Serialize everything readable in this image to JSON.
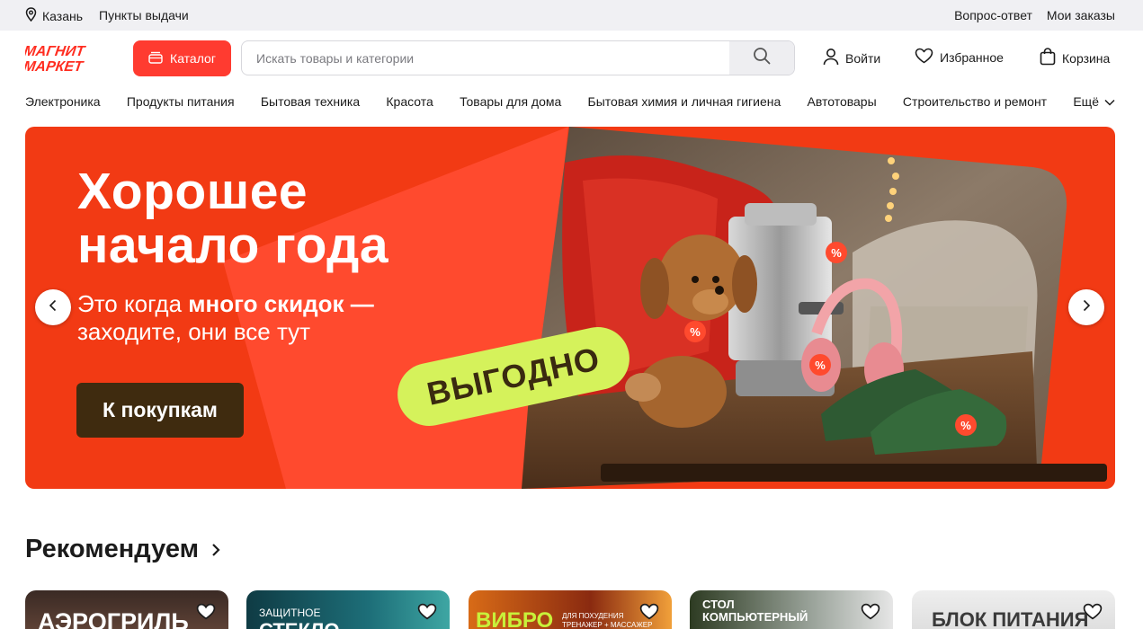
{
  "topbar": {
    "city": "Казань",
    "pickup_points": "Пункты выдачи",
    "faq": "Вопрос-ответ",
    "my_orders": "Мои заказы"
  },
  "header": {
    "logo_line1": "МАГНИТ",
    "logo_line2": "МАРКЕТ",
    "catalog_label": "Каталог",
    "search_placeholder": "Искать товары и категории",
    "login_label": "Войти",
    "favorites_label": "Избранное",
    "cart_label": "Корзина"
  },
  "categories": [
    "Электроника",
    "Продукты питания",
    "Бытовая техника",
    "Красота",
    "Товары для дома",
    "Бытовая химия и личная гигиена",
    "Автотовары",
    "Строительство и ремонт",
    "Ещё"
  ],
  "banner": {
    "title_line1": "Хорошее",
    "title_line2": "начало года",
    "subtitle_part1": "Это когда ",
    "subtitle_bold": "много скидок —",
    "subtitle_line2": "заходите, они все тут",
    "cta_label": "К покупкам",
    "badge_label": "ВЫГОДНО",
    "tag_symbol": "%"
  },
  "recommend": {
    "title": "Рекомендуем",
    "cards": [
      {
        "text": "АЭРОГРИЛЬ"
      },
      {
        "text": "ЗАЩИТНОЕ",
        "text2": "СТЕКЛО"
      },
      {
        "text": "ВИБРО",
        "text2": "ДЛЯ ПОХУДЕНИЯ",
        "text3": "ТРЕНАЖЕР + МАССАЖЕР"
      },
      {
        "text": "СТОЛ",
        "text2": "КОМПЬЮТЕРНЫЙ"
      },
      {
        "text": "БЛОК ПИТАНИЯ"
      }
    ]
  },
  "colors": {
    "brand_red": "#ff3b30",
    "banner_red": "#f23a14",
    "cta_brown": "#3f2b0f",
    "badge_lime": "#d5f25b"
  }
}
